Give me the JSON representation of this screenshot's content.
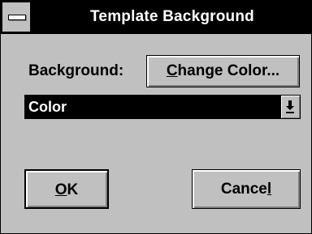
{
  "window": {
    "title": "Template Background",
    "system_menu_icon": "system-menu-icon"
  },
  "background": {
    "label": "Background:",
    "change_color_button": {
      "underlined": "C",
      "rest": "hange Color..."
    }
  },
  "color_select": {
    "selected_value": "Color",
    "dropdown_icon": "down-arrow-icon"
  },
  "buttons": {
    "ok": {
      "underlined": "O",
      "rest": "K"
    },
    "cancel": {
      "before": "Cance",
      "underlined": "l"
    }
  },
  "colors": {
    "title_bar": "#000000",
    "dialog_face": "#c0c0c0",
    "selection": "#000000"
  }
}
